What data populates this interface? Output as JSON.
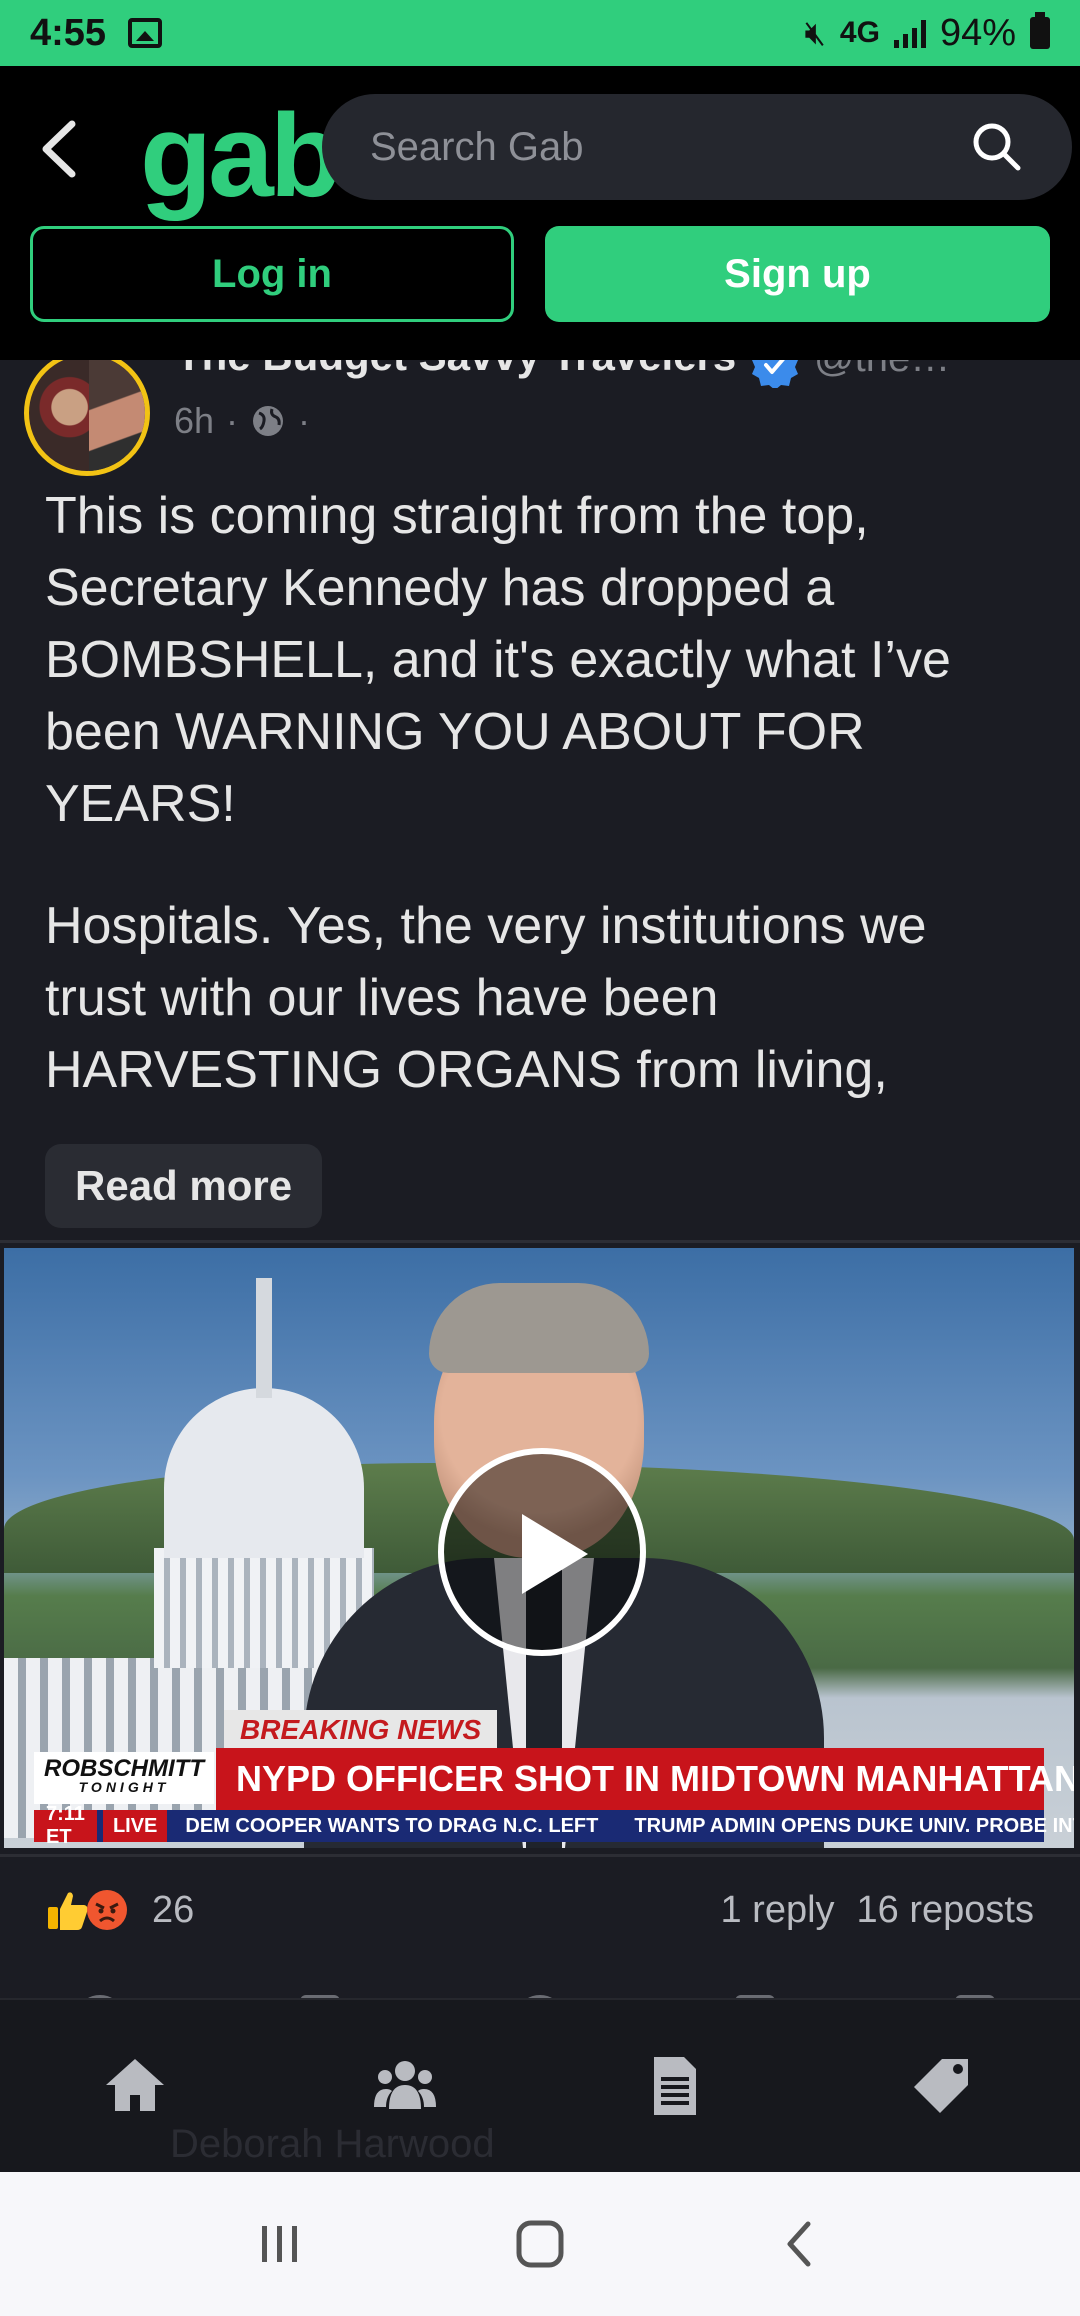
{
  "status_bar": {
    "time": "4:55",
    "network": "4G",
    "battery": "94%"
  },
  "header": {
    "logo": "gab",
    "search_placeholder": "Search Gab",
    "login_label": "Log in",
    "signup_label": "Sign up"
  },
  "post": {
    "author_name": "The Budget Savvy Travelers",
    "author_handle": "@the…",
    "age": "6h",
    "meta_sep": "·",
    "paragraphs": [
      "This is coming straight from the top, Secretary Kennedy has dropped a BOMBSHELL, and it's exactly what I’ve been WARNING YOU ABOUT FOR YEARS!",
      "Hospitals. Yes, the very institutions we trust with our lives have been HARVESTING ORGANS from living,"
    ],
    "read_more_label": "Read more",
    "video": {
      "breaking_label": "BREAKING NEWS",
      "headline": "NYPD OFFICER SHOT IN MIDTOWN MANHATTAN",
      "show_logo": "ROBSCHMITT",
      "show_logo_sub": "TONIGHT",
      "ticker_time": "7:11 ET",
      "ticker_live": "LIVE",
      "ticker_item_1": "DEM COOPER WANTS TO DRAG N.C. LEFT",
      "ticker_item_2": "TRUMP ADMIN OPENS DUKE UNIV. PROBE INTO"
    },
    "stats": {
      "reaction_count": "26",
      "replies": "1 reply",
      "reposts": "16 reposts"
    }
  },
  "ghost_next_author": "Deborah Harwood",
  "colors": {
    "accent": "#30ce7d",
    "background": "#1b1c23",
    "verified": "#3b8beb"
  },
  "icons": {
    "back": "chevron-left-icon",
    "search": "search-icon",
    "verified": "verified-badge-icon",
    "globe": "globe-icon",
    "play": "play-icon",
    "home": "home-icon",
    "groups": "groups-icon",
    "news": "news-icon",
    "tags": "tags-icon"
  }
}
